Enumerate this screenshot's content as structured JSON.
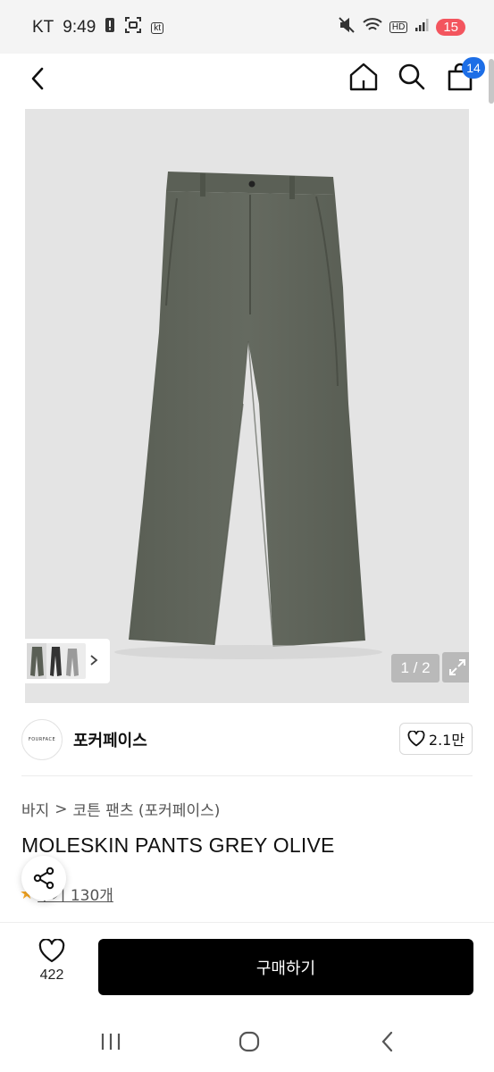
{
  "status_bar": {
    "carrier": "KT",
    "time": "9:49",
    "kt_badge": "kt",
    "hd_label": "HD",
    "battery": "15"
  },
  "header": {
    "cart_count": "14"
  },
  "gallery": {
    "counter": "1 / 2"
  },
  "brand": {
    "name": "포커페이스",
    "logo_text": "FOURFACE",
    "likes": "2.1만"
  },
  "breadcrumb": {
    "category": "바지",
    "separator": ">",
    "subcategory": "코튼 팬츠 (포커페이스)"
  },
  "product": {
    "title": "MOLESKIN PANTS GREY OLIVE",
    "review_text": "후기 130개"
  },
  "bottom_bar": {
    "wish_count": "422",
    "buy_label": "구매하기"
  },
  "colors": {
    "accent_badge": "#1d6ee6",
    "buy_button": "#000000",
    "battery": "#f3555e",
    "pants": "#5f6459"
  }
}
